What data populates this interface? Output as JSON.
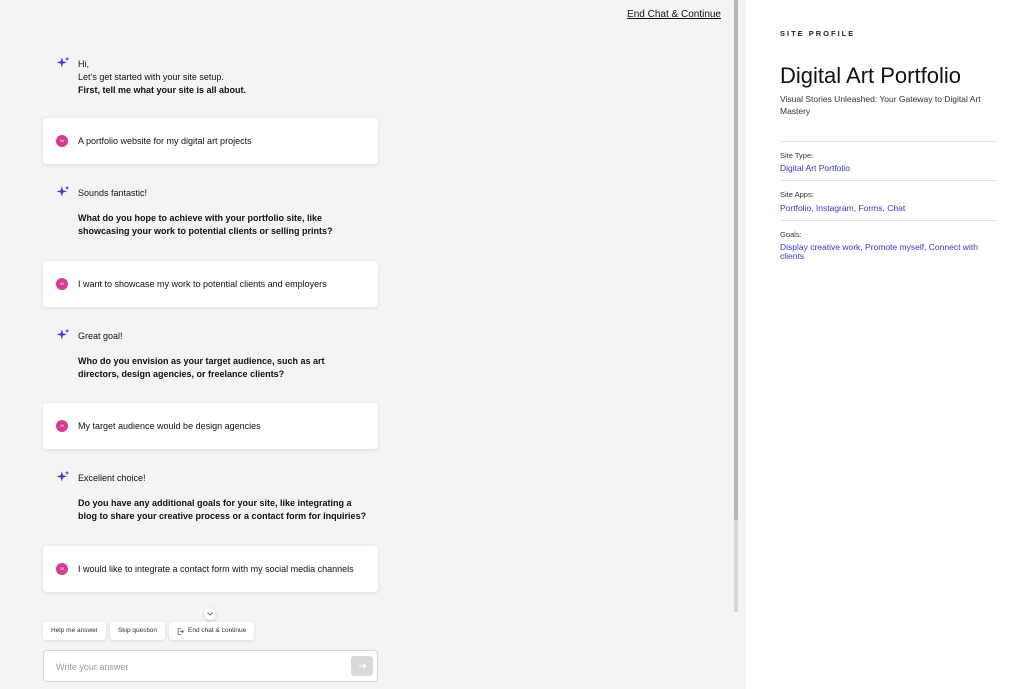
{
  "header": {
    "end_link": "End Chat & Continue"
  },
  "messages": {
    "m1": {
      "lines": [
        "Hi,",
        "Let’s get started with your site setup."
      ],
      "question": "First, tell me what your site is all about."
    },
    "u1": {
      "text": "A portfolio website for my digital art projects"
    },
    "m2": {
      "intro": "Sounds fantastic!",
      "question": "What do you hope to achieve with your portfolio site, like showcasing your work to potential clients or selling prints?"
    },
    "u2": {
      "text": "I want to showcase my work to potential clients and employers"
    },
    "m3": {
      "intro": "Great goal!",
      "question": "Who do you envision as your target audience, such as art directors, design agencies, or freelance clients?"
    },
    "u3": {
      "text": "My target audience would be design agencies"
    },
    "m4": {
      "intro": "Excellent choice!",
      "question": "Do you have any additional goals for your site, like integrating a blog to share your creative process or a contact form for inquiries?"
    },
    "u4": {
      "text": "I would like to integrate a contact form with my social media channels"
    }
  },
  "avatar_initial": "M",
  "chips": {
    "help": "Help me answer",
    "skip": "Skip question",
    "end": "End chat & continue"
  },
  "input": {
    "placeholder": "Write your answer",
    "value": ""
  },
  "profile": {
    "label": "SITE PROFILE",
    "title": "Digital Art Portfolio",
    "subtitle": "Visual Stories Unleashed: Your Gateway to Digital Art Mastery",
    "site_type_label": "Site Type:",
    "site_type_value": "Digital Art Portfolio",
    "site_apps_label": "Site Apps:",
    "site_apps_value": "Portfolio, Instagram, Forms, Chat",
    "goals_label": "Goals:",
    "goals_value": "Display creative work, Promote myself, Connect with clients"
  },
  "icons": {
    "ai": "sparkle-icon",
    "send": "arrow-right-icon",
    "scroll": "chevron-down-icon",
    "end_chip": "exit-icon"
  },
  "colors": {
    "accent": "#3b36d6",
    "avatar": "#d63b8f",
    "sparkle": "#4a3bd6"
  }
}
